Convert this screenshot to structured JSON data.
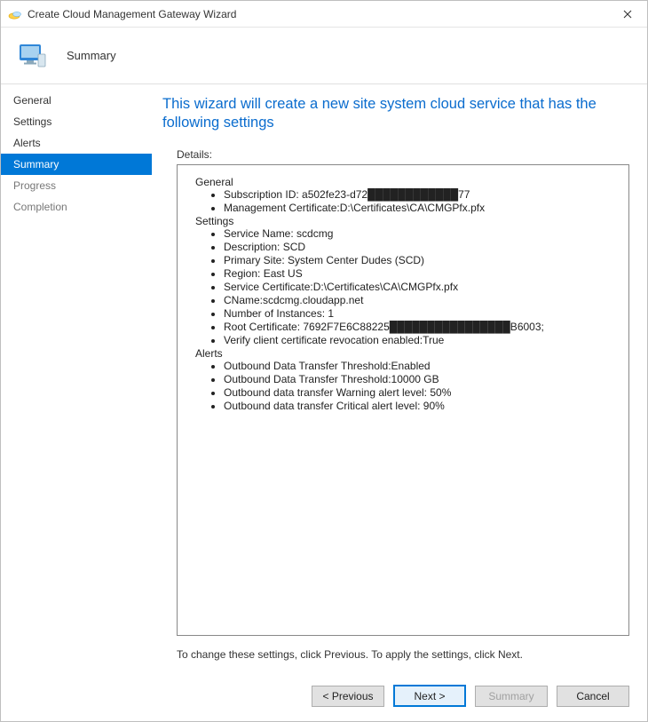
{
  "window": {
    "title": "Create Cloud Management Gateway Wizard"
  },
  "header": {
    "title": "Summary"
  },
  "nav": {
    "items": [
      {
        "label": "General"
      },
      {
        "label": "Settings"
      },
      {
        "label": "Alerts"
      },
      {
        "label": "Summary"
      },
      {
        "label": "Progress"
      },
      {
        "label": "Completion"
      }
    ]
  },
  "content": {
    "headline": "This wizard will create a new site system cloud service that has the following settings",
    "details_label": "Details:",
    "sections": {
      "general": {
        "title": "General",
        "items": [
          "Subscription ID: a502fe23-d72████████████77",
          "Management Certificate:D:\\Certificates\\CA\\CMGPfx.pfx"
        ]
      },
      "settings": {
        "title": "Settings",
        "items": [
          "Service Name: scdcmg",
          "Description: SCD",
          "Primary Site: System Center Dudes (SCD)",
          "Region: East US",
          "Service Certificate:D:\\Certificates\\CA\\CMGPfx.pfx",
          "CName:scdcmg.cloudapp.net",
          "Number of Instances: 1",
          "Root Certificate: 7692F7E6C88225████████████████B6003;",
          "Verify client certificate revocation enabled:True"
        ]
      },
      "alerts": {
        "title": "Alerts",
        "items": [
          "Outbound Data Transfer Threshold:Enabled",
          "Outbound Data Transfer Threshold:10000 GB",
          "Outbound data transfer Warning alert level: 50%",
          "Outbound data transfer Critical alert level: 90%"
        ]
      }
    },
    "hint": "To change these settings, click Previous. To apply the settings, click Next."
  },
  "footer": {
    "previous": "< Previous",
    "next": "Next >",
    "summary": "Summary",
    "cancel": "Cancel"
  }
}
